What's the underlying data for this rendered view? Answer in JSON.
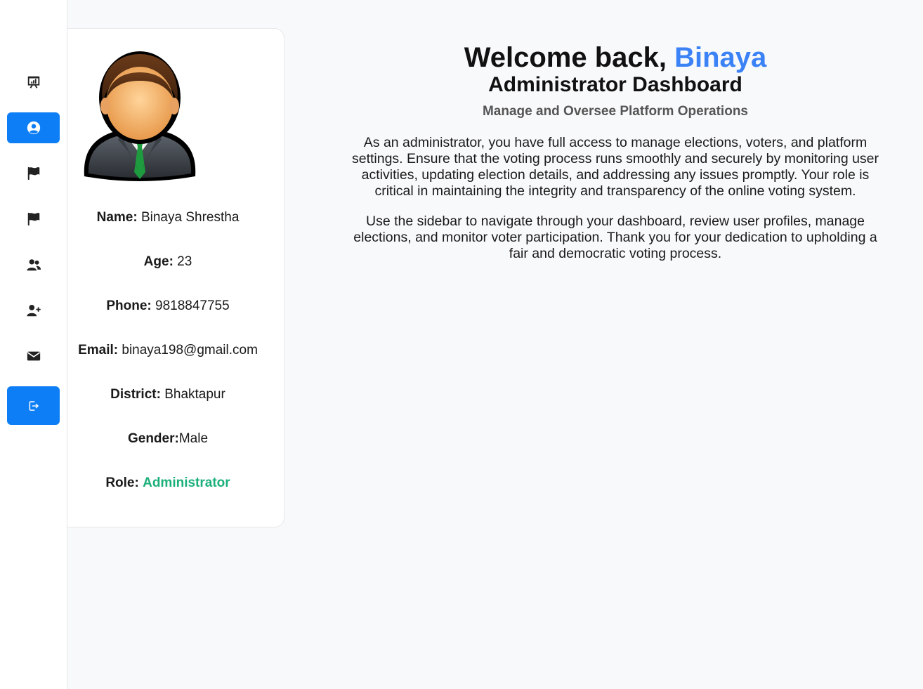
{
  "sidebar": {
    "items": [
      {
        "name": "presentation-chart-icon"
      },
      {
        "name": "user-circle-icon"
      },
      {
        "name": "flag-icon"
      },
      {
        "name": "flag-icon"
      },
      {
        "name": "users-icon"
      },
      {
        "name": "user-plus-icon"
      },
      {
        "name": "envelope-icon"
      },
      {
        "name": "logout-icon"
      }
    ],
    "active_index": 1,
    "accent": "#0d7ef5"
  },
  "profile": {
    "name_label": "Name:",
    "name_value": " Binaya Shrestha",
    "age_label": "Age:",
    "age_value": " 23",
    "phone_label": "Phone:",
    "phone_value": " 9818847755",
    "email_label": "Email:",
    "email_value": " binaya198@gmail.com",
    "district_label": "District:",
    "district_value": " Bhaktapur",
    "gender_label": "Gender:",
    "gender_value": "Male",
    "role_label": "Role:",
    "role_value": "Administrator",
    "role_color": "#1bb07a"
  },
  "main": {
    "welcome_prefix": "Welcome back, ",
    "welcome_user": "Binaya",
    "welcome_user_color": "#3b82f6",
    "dashboard_title": "Administrator Dashboard",
    "subtitle": "Manage and Oversee Platform Operations",
    "paragraph1": "As an administrator, you have full access to manage elections, voters, and platform settings. Ensure that the voting process runs smoothly and securely by monitoring user activities, updating election details, and addressing any issues promptly. Your role is critical in maintaining the integrity and transparency of the online voting system.",
    "paragraph2": "Use the sidebar to navigate through your dashboard, review user profiles, manage elections, and monitor voter participation. Thank you for your dedication to upholding a fair and democratic voting process."
  }
}
